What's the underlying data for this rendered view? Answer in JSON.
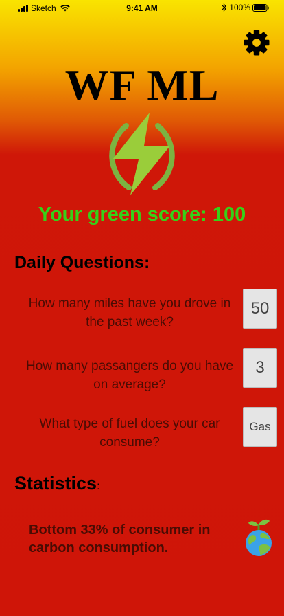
{
  "status_bar": {
    "carrier": "Sketch",
    "time": "9:41 AM",
    "battery": "100%"
  },
  "header": {
    "title": "WF ML",
    "settings_icon": "gear-icon",
    "logo_icon": "lightning-bolt-icon"
  },
  "score": {
    "text": "Your green score: 100"
  },
  "daily_questions": {
    "heading": "Daily Questions:",
    "items": [
      {
        "question": "How many miles have you drove in the past week?",
        "answer": "50"
      },
      {
        "question": "How many passangers do you have on average?",
        "answer": "3"
      },
      {
        "question": "What type of fuel does your car consume?",
        "answer": "Gas"
      }
    ]
  },
  "statistics": {
    "heading": "Statistics",
    "colon": ":",
    "text": "Bottom 33% of consumer in carbon consumption.",
    "icon": "earth-sprout-icon"
  },
  "colors": {
    "score_green": "#37d018",
    "background_red": "#cf1508",
    "background_yellow": "#f9e400",
    "logo_green": "#7cb341"
  }
}
